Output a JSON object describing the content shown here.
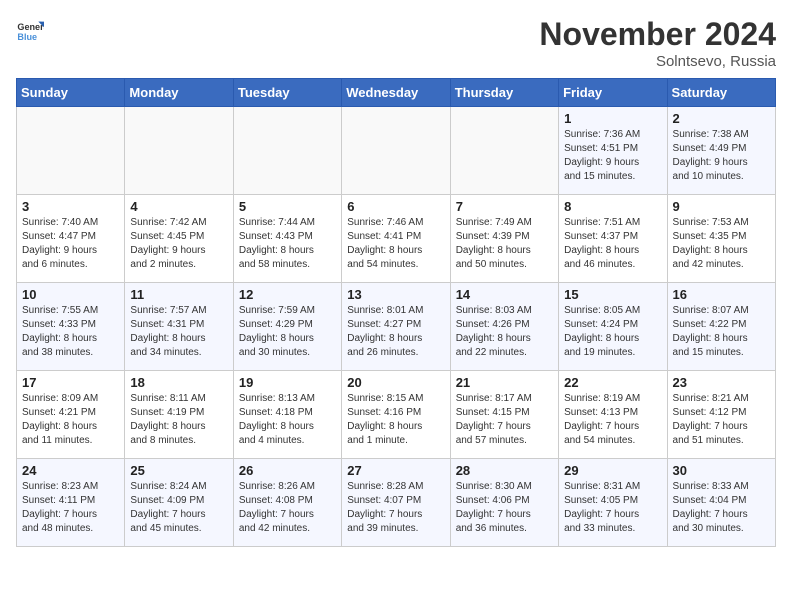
{
  "logo": {
    "text_general": "General",
    "text_blue": "Blue"
  },
  "title": "November 2024",
  "location": "Solntsevo, Russia",
  "days_of_week": [
    "Sunday",
    "Monday",
    "Tuesday",
    "Wednesday",
    "Thursday",
    "Friday",
    "Saturday"
  ],
  "weeks": [
    [
      {
        "day": "",
        "info": ""
      },
      {
        "day": "",
        "info": ""
      },
      {
        "day": "",
        "info": ""
      },
      {
        "day": "",
        "info": ""
      },
      {
        "day": "",
        "info": ""
      },
      {
        "day": "1",
        "info": "Sunrise: 7:36 AM\nSunset: 4:51 PM\nDaylight: 9 hours\nand 15 minutes."
      },
      {
        "day": "2",
        "info": "Sunrise: 7:38 AM\nSunset: 4:49 PM\nDaylight: 9 hours\nand 10 minutes."
      }
    ],
    [
      {
        "day": "3",
        "info": "Sunrise: 7:40 AM\nSunset: 4:47 PM\nDaylight: 9 hours\nand 6 minutes."
      },
      {
        "day": "4",
        "info": "Sunrise: 7:42 AM\nSunset: 4:45 PM\nDaylight: 9 hours\nand 2 minutes."
      },
      {
        "day": "5",
        "info": "Sunrise: 7:44 AM\nSunset: 4:43 PM\nDaylight: 8 hours\nand 58 minutes."
      },
      {
        "day": "6",
        "info": "Sunrise: 7:46 AM\nSunset: 4:41 PM\nDaylight: 8 hours\nand 54 minutes."
      },
      {
        "day": "7",
        "info": "Sunrise: 7:49 AM\nSunset: 4:39 PM\nDaylight: 8 hours\nand 50 minutes."
      },
      {
        "day": "8",
        "info": "Sunrise: 7:51 AM\nSunset: 4:37 PM\nDaylight: 8 hours\nand 46 minutes."
      },
      {
        "day": "9",
        "info": "Sunrise: 7:53 AM\nSunset: 4:35 PM\nDaylight: 8 hours\nand 42 minutes."
      }
    ],
    [
      {
        "day": "10",
        "info": "Sunrise: 7:55 AM\nSunset: 4:33 PM\nDaylight: 8 hours\nand 38 minutes."
      },
      {
        "day": "11",
        "info": "Sunrise: 7:57 AM\nSunset: 4:31 PM\nDaylight: 8 hours\nand 34 minutes."
      },
      {
        "day": "12",
        "info": "Sunrise: 7:59 AM\nSunset: 4:29 PM\nDaylight: 8 hours\nand 30 minutes."
      },
      {
        "day": "13",
        "info": "Sunrise: 8:01 AM\nSunset: 4:27 PM\nDaylight: 8 hours\nand 26 minutes."
      },
      {
        "day": "14",
        "info": "Sunrise: 8:03 AM\nSunset: 4:26 PM\nDaylight: 8 hours\nand 22 minutes."
      },
      {
        "day": "15",
        "info": "Sunrise: 8:05 AM\nSunset: 4:24 PM\nDaylight: 8 hours\nand 19 minutes."
      },
      {
        "day": "16",
        "info": "Sunrise: 8:07 AM\nSunset: 4:22 PM\nDaylight: 8 hours\nand 15 minutes."
      }
    ],
    [
      {
        "day": "17",
        "info": "Sunrise: 8:09 AM\nSunset: 4:21 PM\nDaylight: 8 hours\nand 11 minutes."
      },
      {
        "day": "18",
        "info": "Sunrise: 8:11 AM\nSunset: 4:19 PM\nDaylight: 8 hours\nand 8 minutes."
      },
      {
        "day": "19",
        "info": "Sunrise: 8:13 AM\nSunset: 4:18 PM\nDaylight: 8 hours\nand 4 minutes."
      },
      {
        "day": "20",
        "info": "Sunrise: 8:15 AM\nSunset: 4:16 PM\nDaylight: 8 hours\nand 1 minute."
      },
      {
        "day": "21",
        "info": "Sunrise: 8:17 AM\nSunset: 4:15 PM\nDaylight: 7 hours\nand 57 minutes."
      },
      {
        "day": "22",
        "info": "Sunrise: 8:19 AM\nSunset: 4:13 PM\nDaylight: 7 hours\nand 54 minutes."
      },
      {
        "day": "23",
        "info": "Sunrise: 8:21 AM\nSunset: 4:12 PM\nDaylight: 7 hours\nand 51 minutes."
      }
    ],
    [
      {
        "day": "24",
        "info": "Sunrise: 8:23 AM\nSunset: 4:11 PM\nDaylight: 7 hours\nand 48 minutes."
      },
      {
        "day": "25",
        "info": "Sunrise: 8:24 AM\nSunset: 4:09 PM\nDaylight: 7 hours\nand 45 minutes."
      },
      {
        "day": "26",
        "info": "Sunrise: 8:26 AM\nSunset: 4:08 PM\nDaylight: 7 hours\nand 42 minutes."
      },
      {
        "day": "27",
        "info": "Sunrise: 8:28 AM\nSunset: 4:07 PM\nDaylight: 7 hours\nand 39 minutes."
      },
      {
        "day": "28",
        "info": "Sunrise: 8:30 AM\nSunset: 4:06 PM\nDaylight: 7 hours\nand 36 minutes."
      },
      {
        "day": "29",
        "info": "Sunrise: 8:31 AM\nSunset: 4:05 PM\nDaylight: 7 hours\nand 33 minutes."
      },
      {
        "day": "30",
        "info": "Sunrise: 8:33 AM\nSunset: 4:04 PM\nDaylight: 7 hours\nand 30 minutes."
      }
    ]
  ],
  "colors": {
    "header_bg": "#3a6bbf",
    "odd_row": "#f5f7ff",
    "even_row": "#ffffff"
  }
}
